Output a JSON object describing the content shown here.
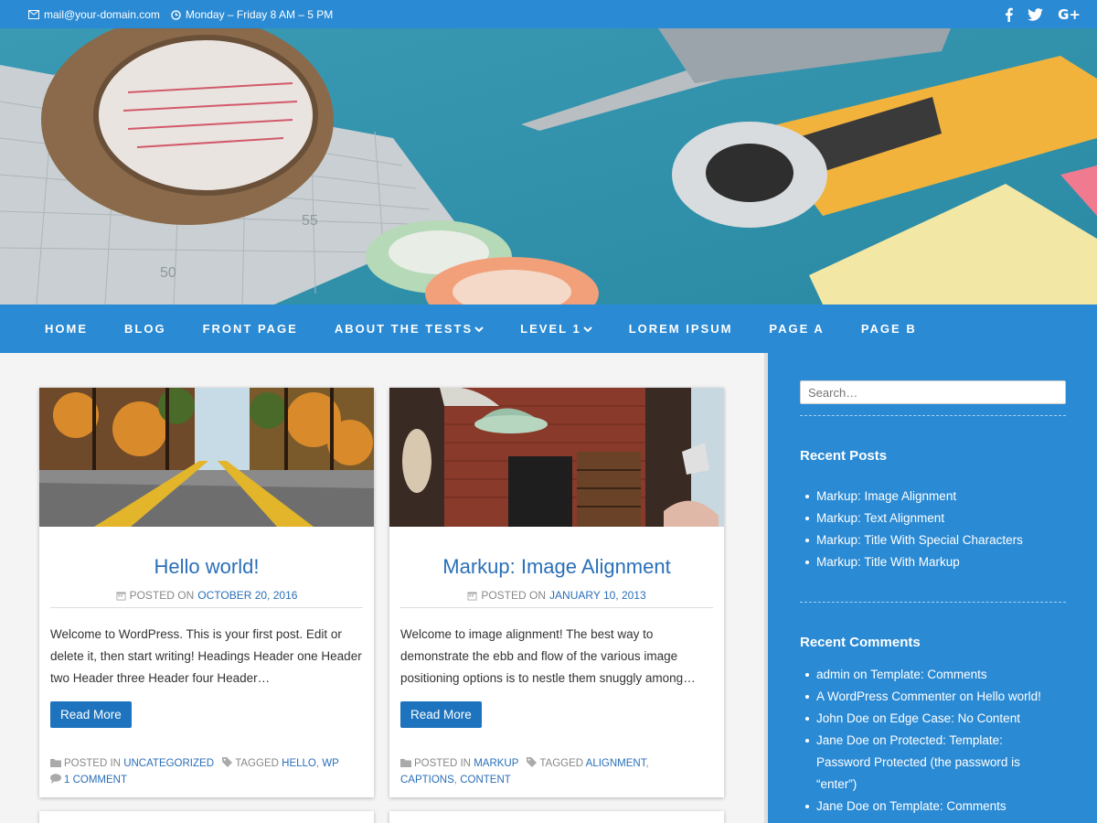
{
  "topbar": {
    "email": "mail@your-domain.com",
    "hours": "Monday – Friday 8 AM – 5 PM",
    "social": [
      "facebook-icon",
      "twitter-icon",
      "google-plus-icon"
    ],
    "gplus_label": "G+"
  },
  "nav": {
    "items": [
      {
        "label": "HOME",
        "has_dropdown": false
      },
      {
        "label": "BLOG",
        "has_dropdown": false
      },
      {
        "label": "FRONT PAGE",
        "has_dropdown": false
      },
      {
        "label": "ABOUT THE TESTS",
        "has_dropdown": true
      },
      {
        "label": "LEVEL 1",
        "has_dropdown": true
      },
      {
        "label": "LOREM IPSUM",
        "has_dropdown": false
      },
      {
        "label": "PAGE A",
        "has_dropdown": false
      },
      {
        "label": "PAGE B",
        "has_dropdown": false
      }
    ]
  },
  "posts": [
    {
      "title": "Hello world!",
      "posted_on_label": "POSTED ON",
      "date": "OCTOBER 20, 2016",
      "excerpt": "Welcome to WordPress. This is your first post. Edit or delete it, then start writing! Headings Header one Header two Header three Header four Header…",
      "read_more": "Read More",
      "posted_in_label": "POSTED IN",
      "category": "UNCATEGORIZED",
      "tagged_label": "TAGGED",
      "tag1": "HELLO",
      "tag2": "WP",
      "comments": "1 COMMENT"
    },
    {
      "title": "Markup: Image Alignment",
      "posted_on_label": "POSTED ON",
      "date": "JANUARY 10, 2013",
      "excerpt": "Welcome to image alignment! The best way to demonstrate the ebb and flow of the various image positioning options is to nestle them snuggly among…",
      "read_more": "Read More",
      "posted_in_label": "POSTED IN",
      "category": "MARKUP",
      "tagged_label": "TAGGED",
      "tag1": "ALIGNMENT",
      "tag2": "CAPTIONS",
      "tag3": "CONTENT"
    }
  ],
  "sidebar": {
    "search_placeholder": "Search…",
    "recent_posts_title": "Recent Posts",
    "recent_posts": [
      "Markup: Image Alignment",
      "Markup: Text Alignment",
      "Markup: Title With Special Characters",
      "Markup: Title With Markup"
    ],
    "recent_comments_title": "Recent Comments",
    "recent_comments": [
      {
        "author": "admin",
        "on": "on",
        "post": "Template: Comments"
      },
      {
        "author": "A WordPress Commenter",
        "on": "on",
        "post": "Hello world!"
      },
      {
        "author": "John Doe",
        "on": "on",
        "post": "Edge Case: No Content"
      },
      {
        "author": "Jane Doe",
        "on": "on",
        "post": "Protected: Template: Password Protected (the password is “enter”)"
      },
      {
        "author": "Jane Doe",
        "on": "on",
        "post": "Template: Comments"
      }
    ]
  },
  "colors": {
    "brand_blue": "#2a8ad4",
    "link_blue": "#2a6fb8",
    "button_blue": "#1e73be"
  }
}
